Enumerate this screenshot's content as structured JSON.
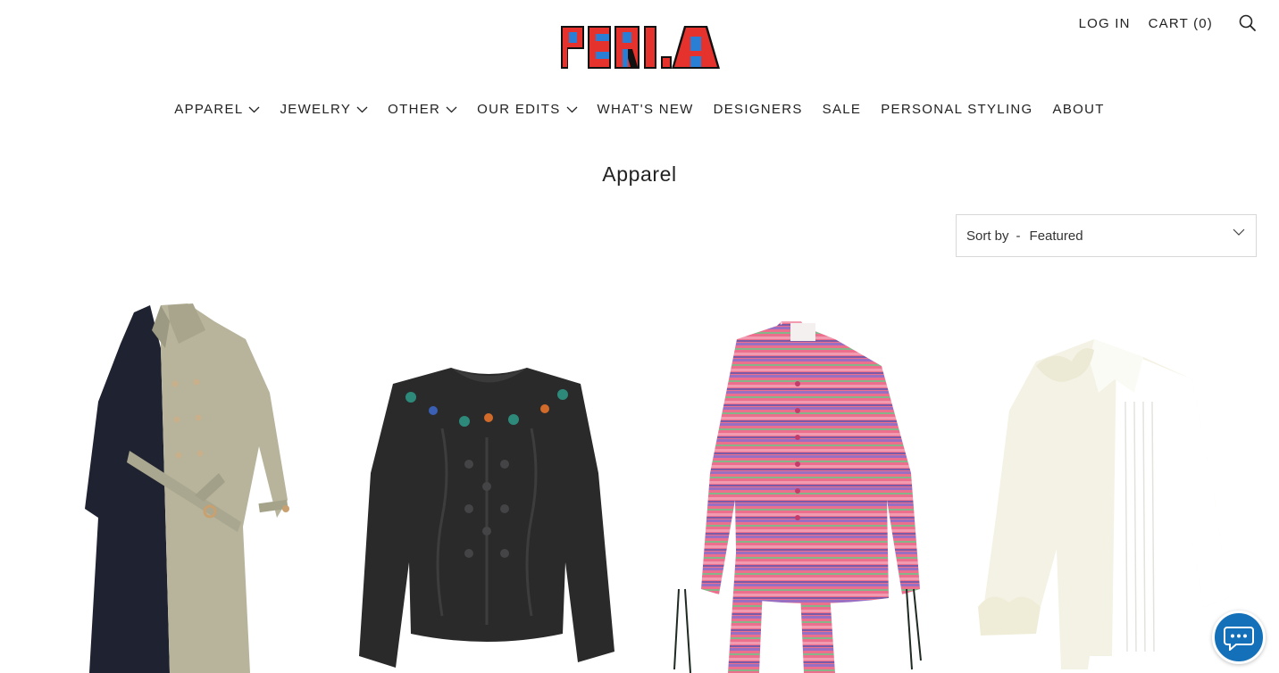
{
  "header": {
    "logo_text": "PERI.A",
    "login_label": "LOG IN",
    "cart_label": "CART (0)",
    "search_icon": "search-icon"
  },
  "nav": {
    "items": [
      {
        "label": "APPAREL",
        "has_dropdown": true
      },
      {
        "label": "JEWELRY",
        "has_dropdown": true
      },
      {
        "label": "OTHER",
        "has_dropdown": true
      },
      {
        "label": "OUR EDITS",
        "has_dropdown": true
      },
      {
        "label": "WHAT'S NEW",
        "has_dropdown": false
      },
      {
        "label": "DESIGNERS",
        "has_dropdown": false
      },
      {
        "label": "SALE",
        "has_dropdown": false
      },
      {
        "label": "PERSONAL STYLING",
        "has_dropdown": false
      },
      {
        "label": "ABOUT",
        "has_dropdown": false
      }
    ]
  },
  "page": {
    "title": "Apparel"
  },
  "sort": {
    "label": "Sort by",
    "separator": "-",
    "value": "Featured"
  },
  "products": [
    {
      "image": "trench-coat-image"
    },
    {
      "image": "black-sweater-image"
    },
    {
      "image": "pink-striped-shirt-image"
    },
    {
      "image": "white-ruffle-shirt-image"
    }
  ],
  "chat": {
    "icon": "chat-icon",
    "color": "#1470b8"
  },
  "colors": {
    "logo_red": "#e5322d",
    "logo_blue": "#2a7fd4",
    "text": "#222222"
  }
}
